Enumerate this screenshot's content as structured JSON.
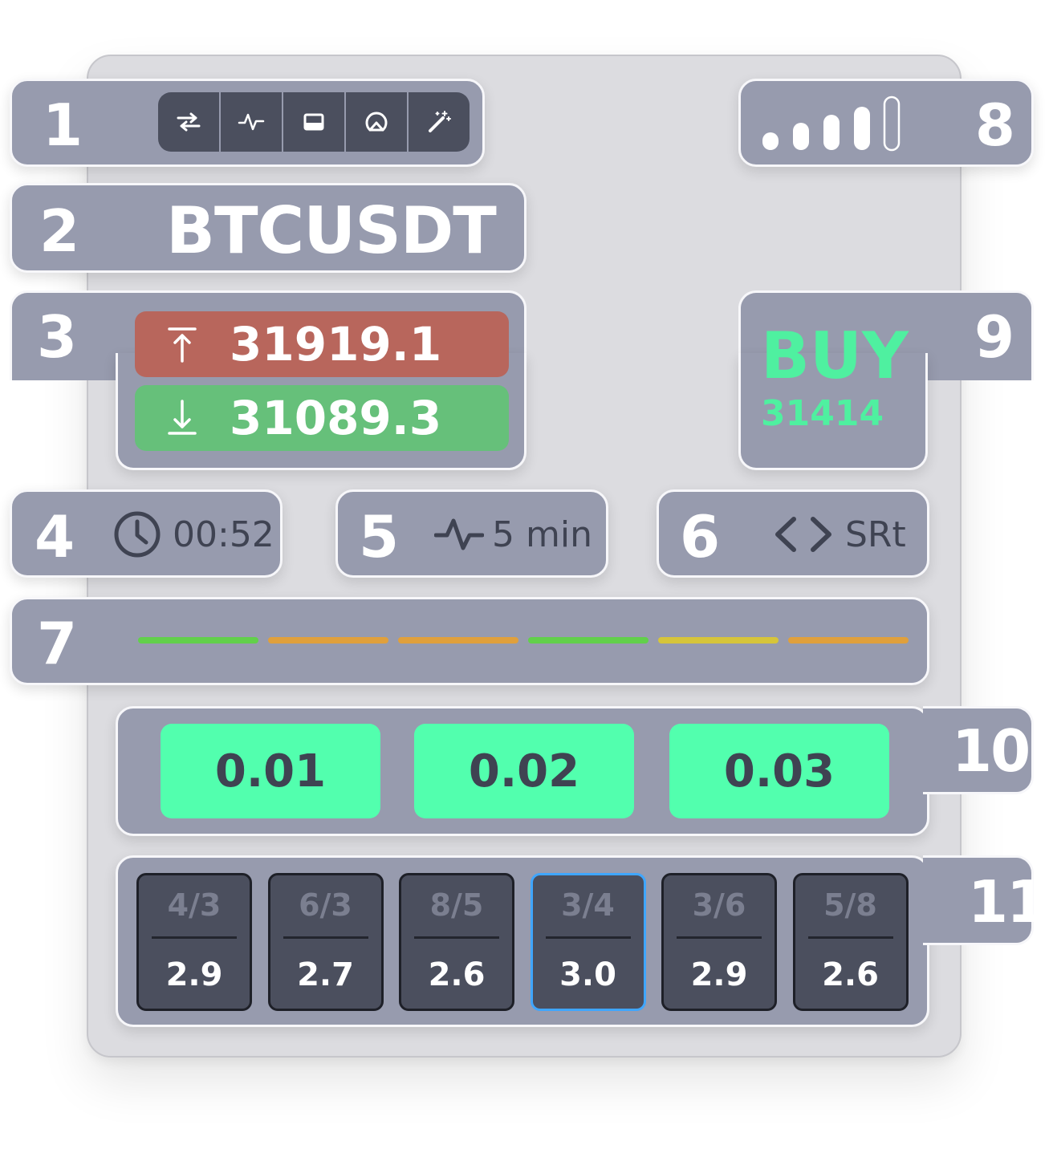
{
  "sections": {
    "s1": "1",
    "s2": "2",
    "s3": "3",
    "s4": "4",
    "s5": "5",
    "s6": "6",
    "s7": "7",
    "s8": "8",
    "s9": "9",
    "s10": "10",
    "s11": "11"
  },
  "toolbar": {
    "icons": [
      "swap-arrows-icon",
      "pulse-icon",
      "window-icon",
      "gauge-icon",
      "magic-wand-icon"
    ]
  },
  "symbol": "BTCUSDT",
  "prices": {
    "high": "31919.1",
    "low": "31089.3"
  },
  "signal": {
    "label": "BUY",
    "value": "31414",
    "color": "#4ff0a0"
  },
  "timer": {
    "value": "00:52"
  },
  "timeframe": {
    "value": "5 min"
  },
  "strategy": {
    "value": "SRt"
  },
  "indicators": [
    "#62d04b",
    "#e0a03c",
    "#e0a03c",
    "#62d04b",
    "#d6c53a",
    "#e0a03c"
  ],
  "signal_strength": {
    "filled_bars": 4,
    "total_bars": 5
  },
  "lots": [
    "0.01",
    "0.02",
    "0.03"
  ],
  "ratios": [
    {
      "top": "4/3",
      "bottom": "2.9"
    },
    {
      "top": "6/3",
      "bottom": "2.7"
    },
    {
      "top": "8/5",
      "bottom": "2.6"
    },
    {
      "top": "3/4",
      "bottom": "3.0",
      "selected": true
    },
    {
      "top": "3/6",
      "bottom": "2.9"
    },
    {
      "top": "5/8",
      "bottom": "2.6"
    }
  ]
}
